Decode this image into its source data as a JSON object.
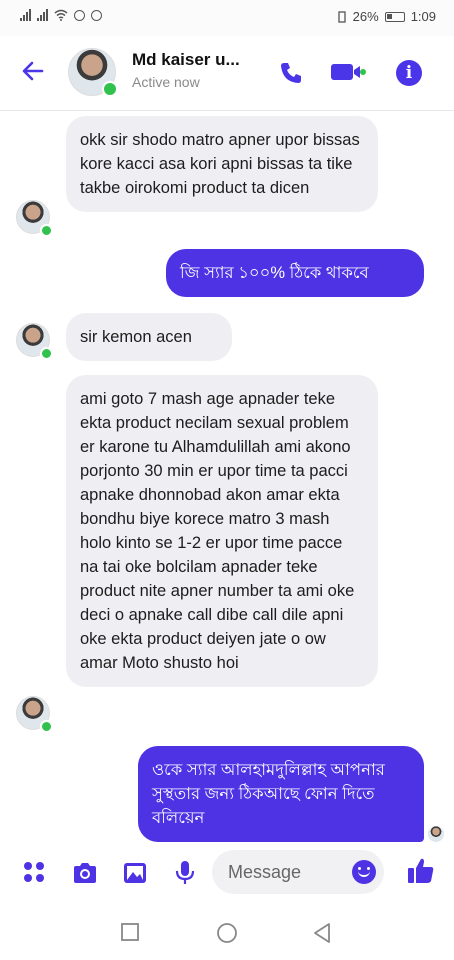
{
  "status_bar": {
    "battery": "26%",
    "time": "1:09"
  },
  "header": {
    "contact_name": "Md kaiser u...",
    "contact_status": "Active now",
    "icons": [
      "back-arrow-icon",
      "phone-icon",
      "video-camera-icon",
      "info-icon"
    ]
  },
  "messages": [
    {
      "direction": "in",
      "text": "okk sir shodo matro apner upor bissas kore kacci asa kori apni bissas ta tike takbe oirokomi product ta dicen"
    },
    {
      "direction": "out",
      "text": "জি স্যার ১০০% ঠিকে থাকবে"
    },
    {
      "direction": "in",
      "text": "sir kemon acen"
    },
    {
      "direction": "in",
      "text": "ami goto 7 mash age apnader teke ekta product necilam sexual problem er karone tu Alhamdulillah ami akono porjonto 30 min er upor time ta pacci apnake dhonnobad akon amar ekta bondhu biye korece matro 3 mash holo kinto se 1-2 er upor time pacce na tai oke bolcilam apnader teke product nite apner number ta ami oke deci o apnake call dibe call dile apni oke ekta product deiyen jate o ow amar Moto shusto hoi"
    },
    {
      "direction": "out",
      "text": "ওকে স্যার আলহামদুলিল্লাহ আপনার সুস্থতার জন্য ঠিকআছে ফোন দিতে বলিয়েন"
    }
  ],
  "composer": {
    "placeholder": "Message",
    "icons": [
      "apps-icon",
      "camera-icon",
      "image-icon",
      "microphone-icon",
      "emoji-icon",
      "thumbs-up-icon"
    ]
  },
  "navigation": {
    "icons": [
      "recent-apps-icon",
      "home-icon",
      "back-icon"
    ]
  },
  "colors": {
    "accent": "#4e33e5",
    "incoming_bubble": "#efeef3",
    "online": "#31c24d"
  }
}
